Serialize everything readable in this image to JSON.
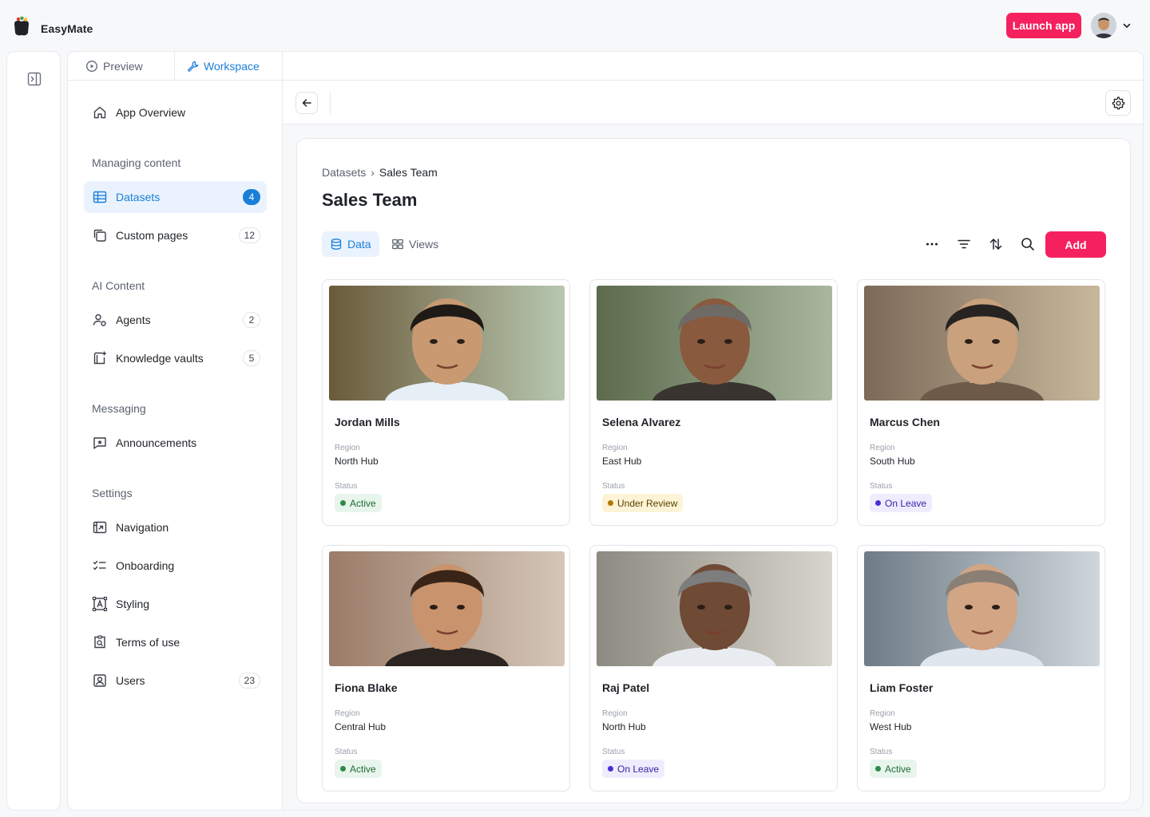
{
  "app": {
    "name": "EasyMate",
    "launch_label": "Launch app"
  },
  "colors": {
    "accent": "#1a7fd8",
    "brand": "#f5215e",
    "status_active": "#2e8a4a",
    "status_review": "#b07a00",
    "status_leave": "#4b2ed1"
  },
  "sidebar": {
    "tabs": {
      "preview": "Preview",
      "workspace": "Workspace"
    },
    "overview": "App Overview",
    "sections": {
      "managing": "Managing content",
      "ai": "AI Content",
      "messaging": "Messaging",
      "settings": "Settings"
    },
    "items": {
      "datasets": {
        "label": "Datasets",
        "count": "4"
      },
      "custom_pages": {
        "label": "Custom pages",
        "count": "12"
      },
      "agents": {
        "label": "Agents",
        "count": "2"
      },
      "knowledge": {
        "label": "Knowledge vaults",
        "count": "5"
      },
      "announcements": {
        "label": "Announcements"
      },
      "navigation": {
        "label": "Navigation"
      },
      "onboarding": {
        "label": "Onboarding"
      },
      "styling": {
        "label": "Styling"
      },
      "terms": {
        "label": "Terms of use"
      },
      "users": {
        "label": "Users",
        "count": "23"
      }
    }
  },
  "main": {
    "breadcrumb": {
      "root": "Datasets",
      "sep": "›",
      "current": "Sales Team"
    },
    "title": "Sales Team",
    "view_tabs": {
      "data": "Data",
      "views": "Views"
    },
    "add_label": "Add",
    "field_labels": {
      "region": "Region",
      "status": "Status"
    },
    "cards": [
      {
        "name": "Jordan Mills",
        "region": "North Hub",
        "status": "Active"
      },
      {
        "name": "Selena Alvarez",
        "region": "East Hub",
        "status": "Under Review"
      },
      {
        "name": "Marcus Chen",
        "region": "South Hub",
        "status": "On Leave"
      },
      {
        "name": "Fiona Blake",
        "region": "Central Hub",
        "status": "Active"
      },
      {
        "name": "Raj Patel",
        "region": "North Hub",
        "status": "On Leave"
      },
      {
        "name": "Liam Foster",
        "region": "West Hub",
        "status": "Active"
      }
    ]
  }
}
